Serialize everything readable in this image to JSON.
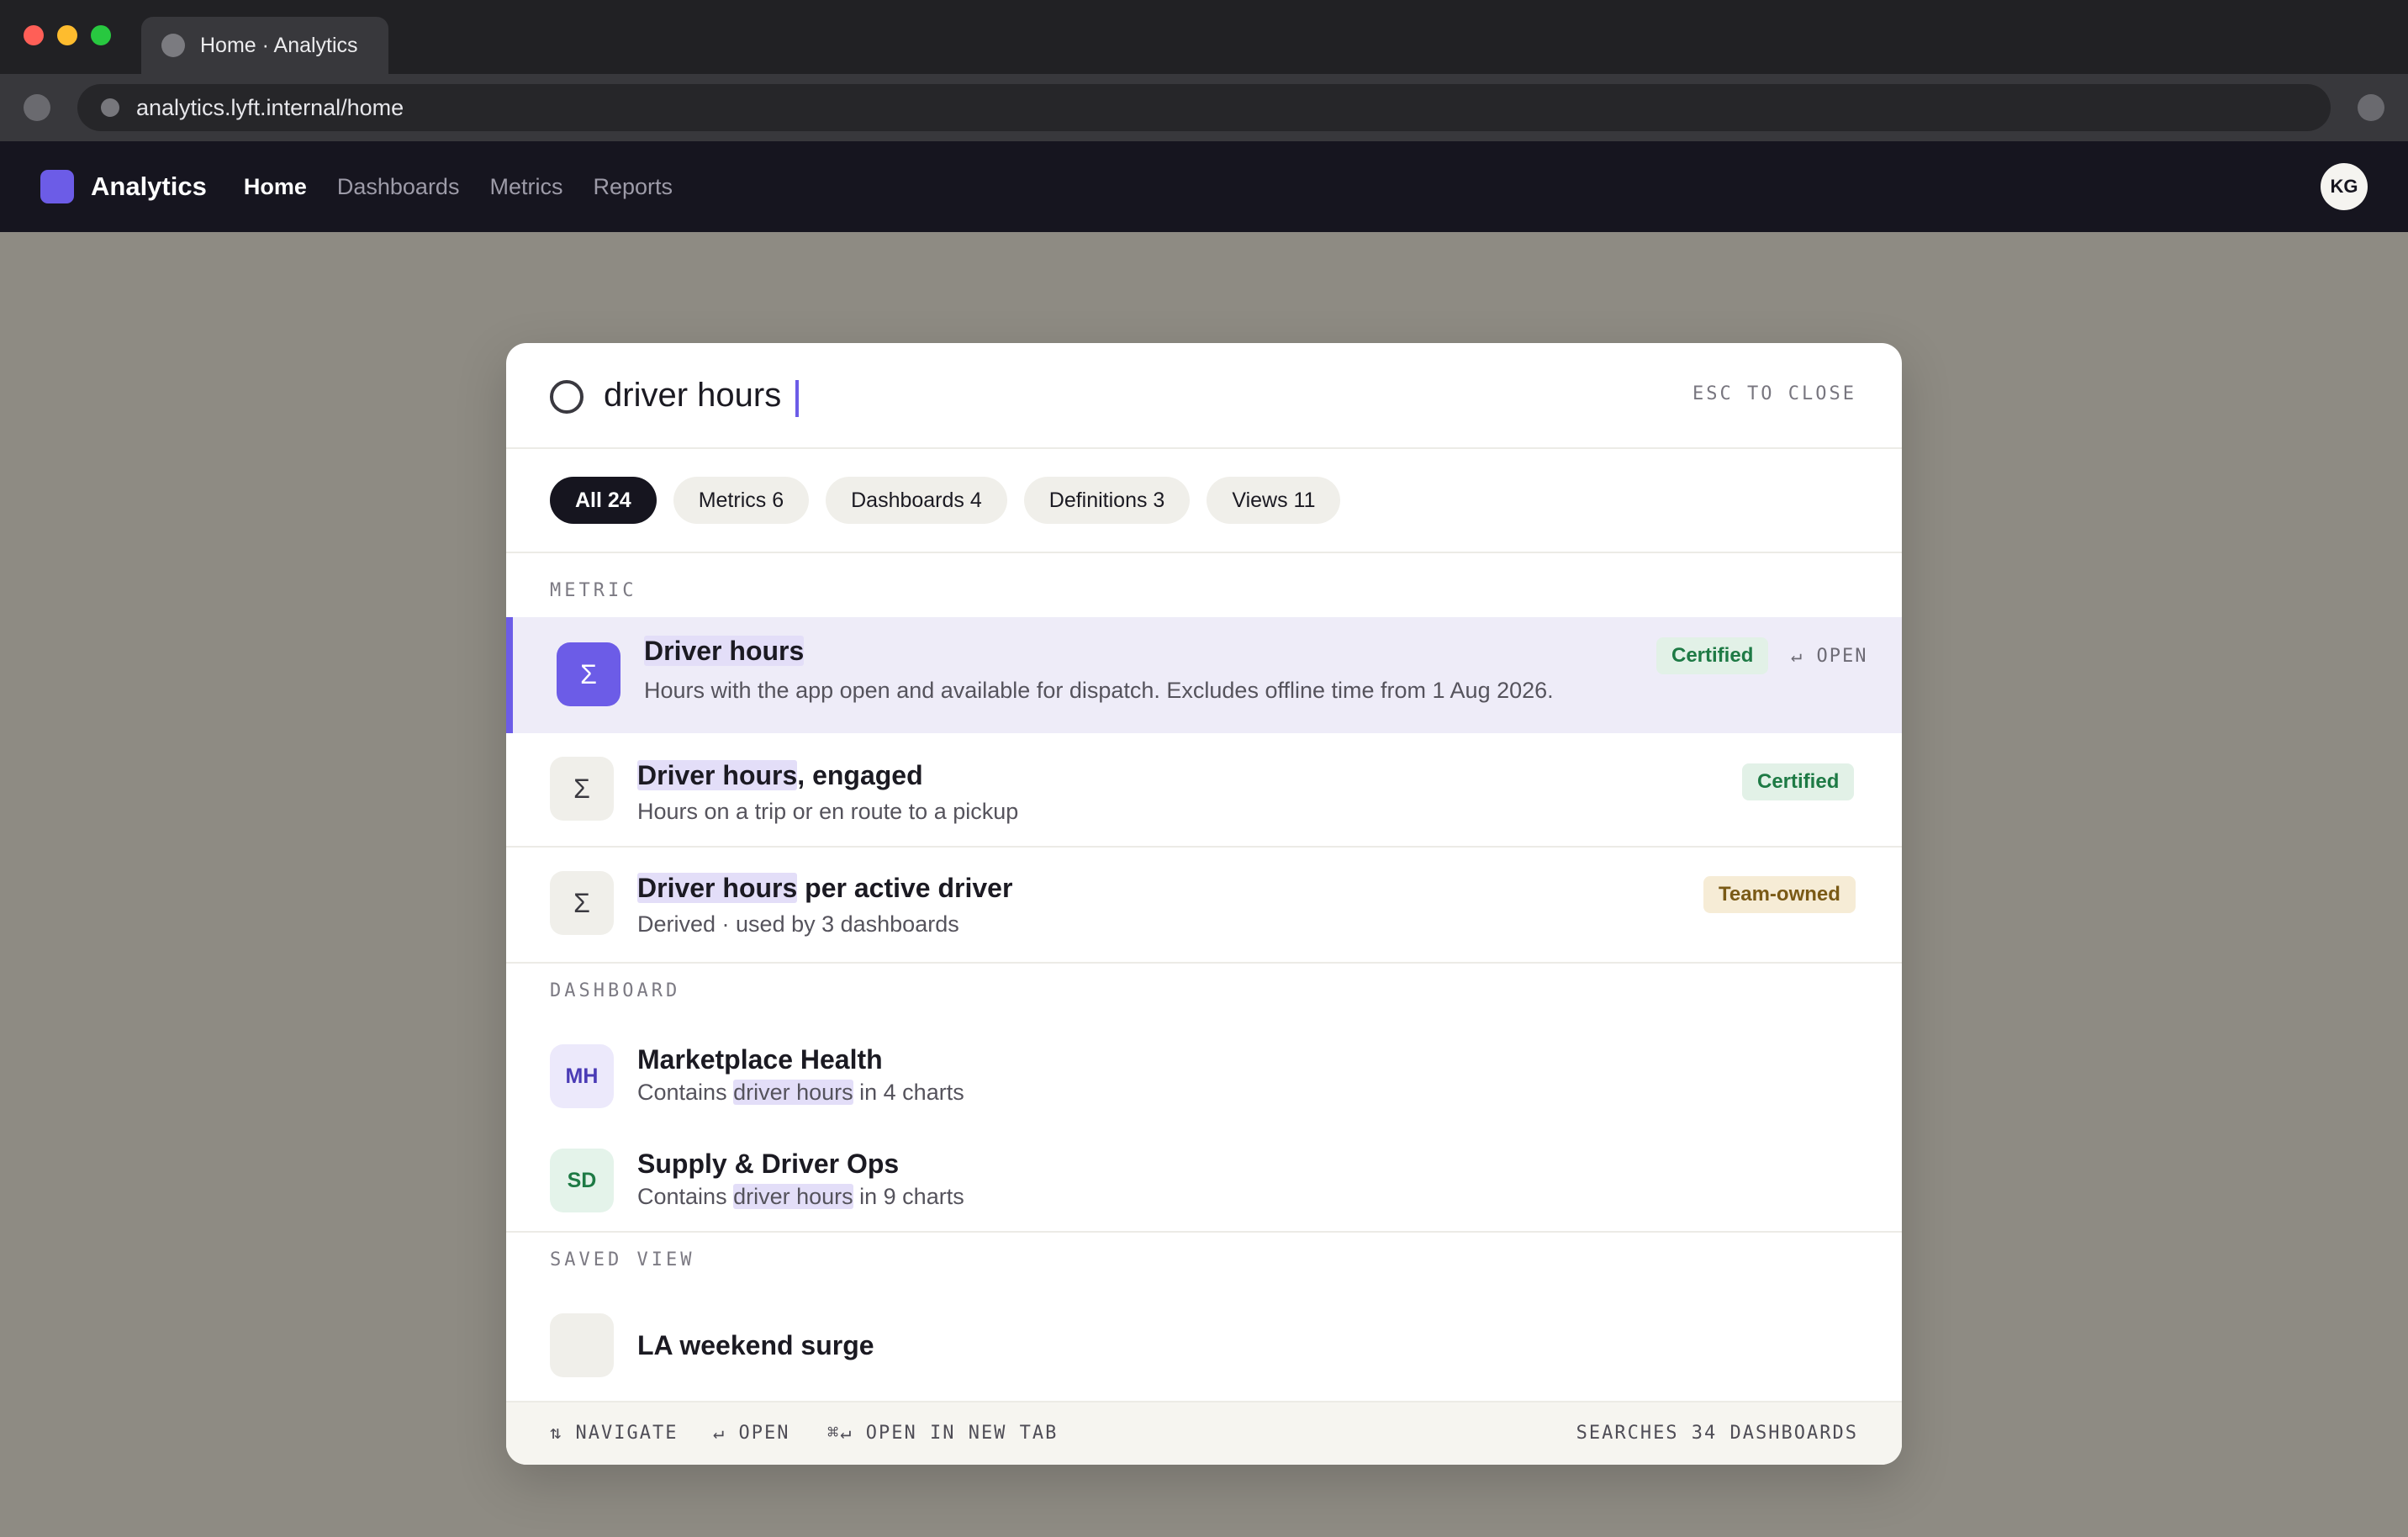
{
  "browser": {
    "tab_title": "Home · Analytics",
    "url": "analytics.lyft.internal/home"
  },
  "app": {
    "name": "Analytics",
    "nav": [
      "Home",
      "Dashboards",
      "Metrics",
      "Reports"
    ],
    "active_nav": "Home",
    "avatar_initials": "KG",
    "accent_color": "#6c5ce7"
  },
  "palette": {
    "query": "driver hours",
    "esc_hint": "ESC TO CLOSE",
    "filters": [
      {
        "label": "All 24",
        "active": true
      },
      {
        "label": "Metrics 6",
        "active": false
      },
      {
        "label": "Dashboards 4",
        "active": false
      },
      {
        "label": "Definitions 3",
        "active": false
      },
      {
        "label": "Views 11",
        "active": false
      }
    ],
    "sections": {
      "metric": "METRIC",
      "dashboard": "DASHBOARD",
      "saved_view": "SAVED VIEW"
    },
    "metrics": [
      {
        "icon": "sigma-icon",
        "glyph": "Σ",
        "title_hl": "Driver hours",
        "title_rest": "",
        "desc": "Hours with the app open and available for dispatch. Excludes offline time from 1 Aug 2026.",
        "badge": "Certified",
        "open_hint": "↵ OPEN",
        "selected": true
      },
      {
        "icon": "sigma-icon",
        "glyph": "Σ",
        "title_hl": "Driver hours",
        "title_rest": ", engaged",
        "desc": "Hours on a trip or en route to a pickup",
        "badge": "Certified"
      },
      {
        "icon": "sigma-icon",
        "glyph": "Σ",
        "title_hl": "Driver hours",
        "title_rest": " per active driver",
        "desc": "Derived · used by 3 dashboards",
        "badge": "Team-owned"
      }
    ],
    "dashboards": [
      {
        "initials": "MH",
        "title": "Marketplace Health",
        "desc_pre": "Contains ",
        "desc_hl": "driver hours",
        "desc_post": " in 4 charts"
      },
      {
        "initials": "SD",
        "title": "Supply & Driver Ops",
        "desc_pre": "Contains ",
        "desc_hl": "driver hours",
        "desc_post": " in 9 charts"
      }
    ],
    "saved_views": [
      {
        "title": "LA weekend surge"
      }
    ],
    "footer": {
      "navigate": "⇅ NAVIGATE",
      "open": "↵ OPEN",
      "open_new_tab": "⌘↵ OPEN IN NEW TAB",
      "scope": "SEARCHES 34 DASHBOARDS"
    }
  }
}
